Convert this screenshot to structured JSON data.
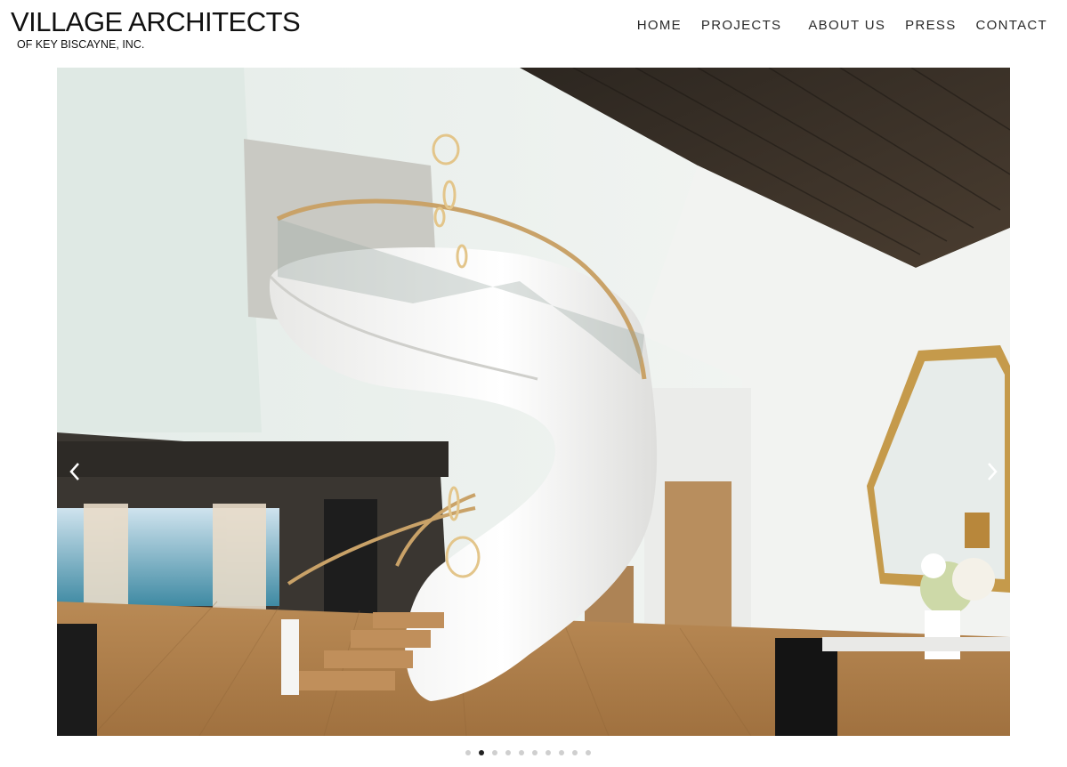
{
  "brand": {
    "title": "VILLAGE ARCHITECTS",
    "subtitle": "OF KEY BISCAYNE, INC."
  },
  "nav": [
    {
      "label": "HOME"
    },
    {
      "label": "PROJECTS"
    },
    {
      "label": "ABOUT US"
    },
    {
      "label": "PRESS"
    },
    {
      "label": "CONTACT"
    }
  ],
  "slideshow": {
    "image": "spiral-staircase-interior",
    "slide_count": 10,
    "active_slide": 2
  },
  "icons": {
    "prev": "chevron-left-icon",
    "next": "chevron-right-icon"
  },
  "colors": {
    "text": "#111111",
    "dot_inactive": "#cfcfcf",
    "dot_active": "#222222"
  }
}
